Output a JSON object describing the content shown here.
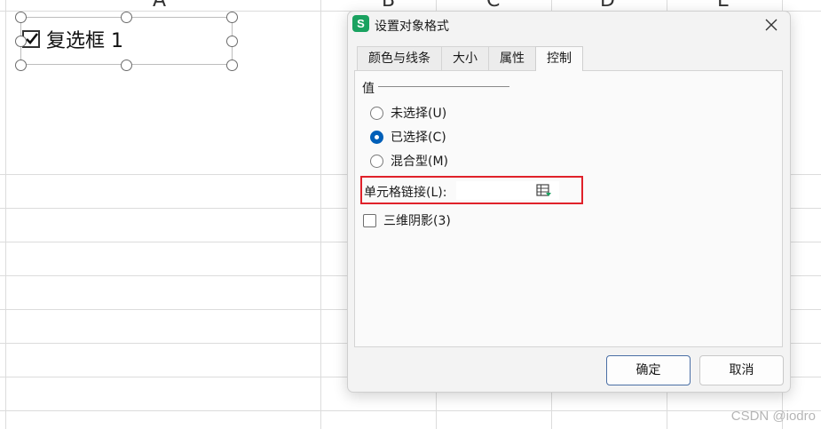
{
  "sheet": {
    "columns": [
      "A",
      "B",
      "C",
      "D",
      "E"
    ],
    "form_control_label": "复选框 1"
  },
  "dialog": {
    "app_icon_letter": "S",
    "title": "设置对象格式",
    "tabs": [
      {
        "label": "颜色与线条",
        "active": false
      },
      {
        "label": "大小",
        "active": false
      },
      {
        "label": "属性",
        "active": false
      },
      {
        "label": "控制",
        "active": true
      }
    ],
    "value_group": {
      "title": "值",
      "options": [
        {
          "label": "未选择(U)",
          "checked": false
        },
        {
          "label": "已选择(C)",
          "checked": true
        },
        {
          "label": "混合型(M)",
          "checked": false
        }
      ]
    },
    "cell_link": {
      "label": "单元格链接(L):",
      "value": ""
    },
    "shading": {
      "label": "三维阴影(3)",
      "checked": false
    },
    "buttons": {
      "ok": "确定",
      "cancel": "取消"
    }
  },
  "watermark": "CSDN @iodro",
  "colors": {
    "accent": "#005fb8",
    "highlight_border": "#e0212a",
    "app_icon": "#1aa260"
  }
}
